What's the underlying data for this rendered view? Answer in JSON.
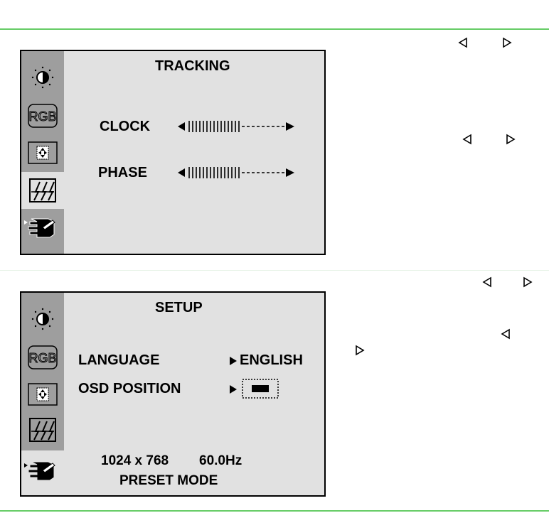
{
  "osd_tracking": {
    "title": "TRACKING",
    "menu_icons": [
      "brightness-contrast-icon",
      "rgb-icon",
      "position-icon",
      "tracking-icon",
      "setup-hand-icon"
    ],
    "active_icon": "tracking-icon",
    "rows": [
      {
        "label": "CLOCK",
        "value": 0.55
      },
      {
        "label": "PHASE",
        "value": 0.55
      }
    ]
  },
  "osd_setup": {
    "title": "SETUP",
    "menu_icons": [
      "brightness-contrast-icon",
      "rgb-icon",
      "position-icon",
      "tracking-icon",
      "setup-hand-icon"
    ],
    "active_icon": "setup-hand-icon",
    "language_label": "LANGUAGE",
    "language_value": "ENGLISH",
    "osd_position_label": "OSD POSITION",
    "resolution": "1024 x 768",
    "refresh": "60.0Hz",
    "mode": "PRESET MODE"
  },
  "side_glyphs": [
    "left-triangle-icon",
    "right-triangle-icon"
  ],
  "colors": {
    "rule": "#66cc66",
    "osd_bg": "#e1e1e1",
    "sidebar": "#9e9e9e"
  }
}
